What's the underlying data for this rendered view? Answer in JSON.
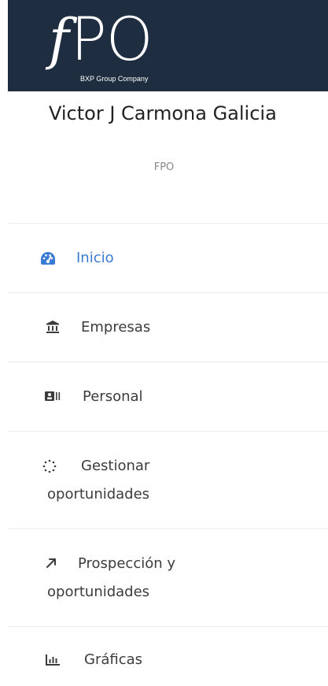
{
  "brand": {
    "logo_f": "f",
    "logo_po": "PO",
    "tagline": "BXP Group Company"
  },
  "user": {
    "name": "Victor J Carmona Galicia",
    "company": "FPO"
  },
  "nav": {
    "inicio": {
      "label": "Inicio",
      "icon": "dashboard-gauge-icon"
    },
    "empresas": {
      "label": "Empresas",
      "icon": "bank-building-icon"
    },
    "personal": {
      "label": "Personal",
      "icon": "id-card-icon"
    },
    "gestionar": {
      "label_line1": "Gestionar",
      "label_line2": "oportunidades",
      "icon": "spinner-icon"
    },
    "prospeccion": {
      "label_line1": "Prospección y",
      "label_line2": "oportunidades",
      "icon": "arrow-up-right-icon"
    },
    "graficas": {
      "label": "Gráficas",
      "icon": "bar-chart-icon"
    }
  },
  "colors": {
    "brand_bg": "#1e2d3f",
    "active": "#3a7bd5",
    "text": "#3c3c3c",
    "divider": "#ececec"
  }
}
